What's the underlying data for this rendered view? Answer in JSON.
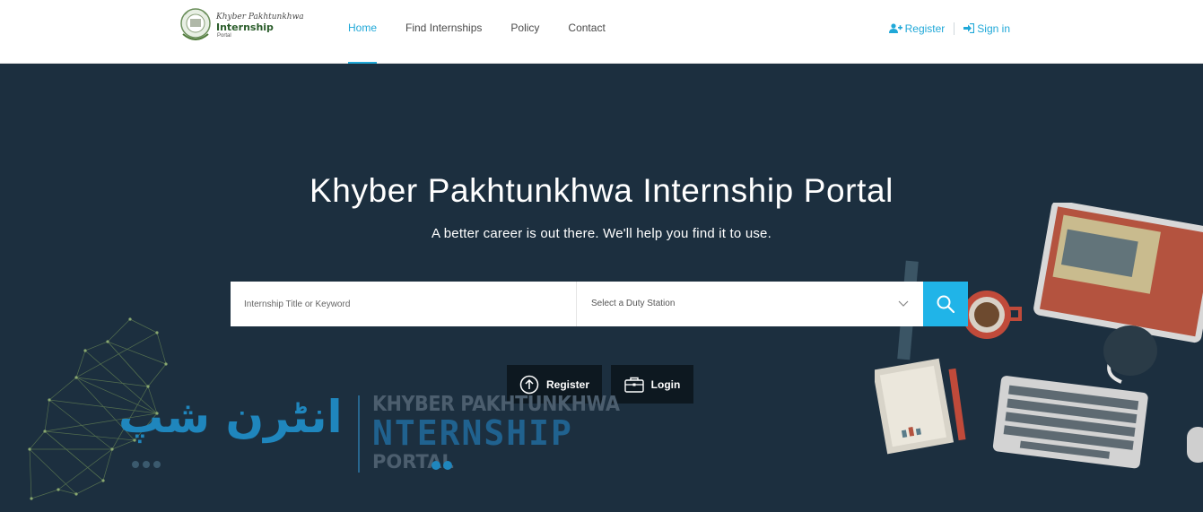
{
  "logo": {
    "line1": "Khyber Pakhtunkhwa",
    "line2": "Internship",
    "line3": "Portal"
  },
  "nav": {
    "items": [
      {
        "label": "Home",
        "active": true
      },
      {
        "label": "Find Internships",
        "active": false
      },
      {
        "label": "Policy",
        "active": false
      },
      {
        "label": "Contact",
        "active": false
      }
    ]
  },
  "auth": {
    "register_label": "Register",
    "signin_label": "Sign in"
  },
  "hero": {
    "title": "Khyber Pakhtunkhwa Internship Portal",
    "subtitle": "A better career is out there. We'll help you find it to use.",
    "search": {
      "keyword_placeholder": "Internship Title or Keyword",
      "station_placeholder": "Select a Duty Station"
    },
    "buttons": {
      "register": "Register",
      "login": "Login"
    }
  },
  "watermark": {
    "urdu": "انٹرن شپ",
    "line1": "KHYBER PAKHTUNKHWA",
    "line2": "NTERNSHIP",
    "line3": "PORTAL"
  },
  "colors": {
    "accent": "#20a8d8",
    "hero_bg": "#1c2f3f",
    "button_bg": "#0d1820",
    "search_button": "#20b4e8"
  }
}
